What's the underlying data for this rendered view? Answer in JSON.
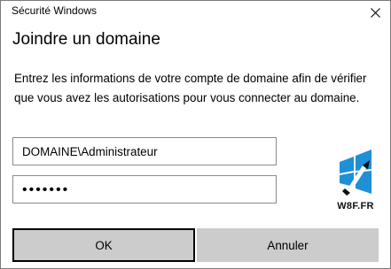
{
  "window": {
    "title": "Sécurité Windows",
    "close_icon": "close-icon"
  },
  "dialog": {
    "heading": "Joindre un domaine",
    "description": "Entrez les informations de votre compte de domaine afin de vérifier que vous avez les autorisations pour vous connecter au domaine."
  },
  "form": {
    "username_value": "DOMAINE\\Administrateur",
    "password_value": "•••••••"
  },
  "watermark": {
    "icon": "windows-logo-icon",
    "text": "W8F.FR"
  },
  "buttons": {
    "ok_label": "OK",
    "cancel_label": "Annuler"
  },
  "colors": {
    "button_bg": "#cccccc",
    "logo_blue": "#1e90d6"
  }
}
